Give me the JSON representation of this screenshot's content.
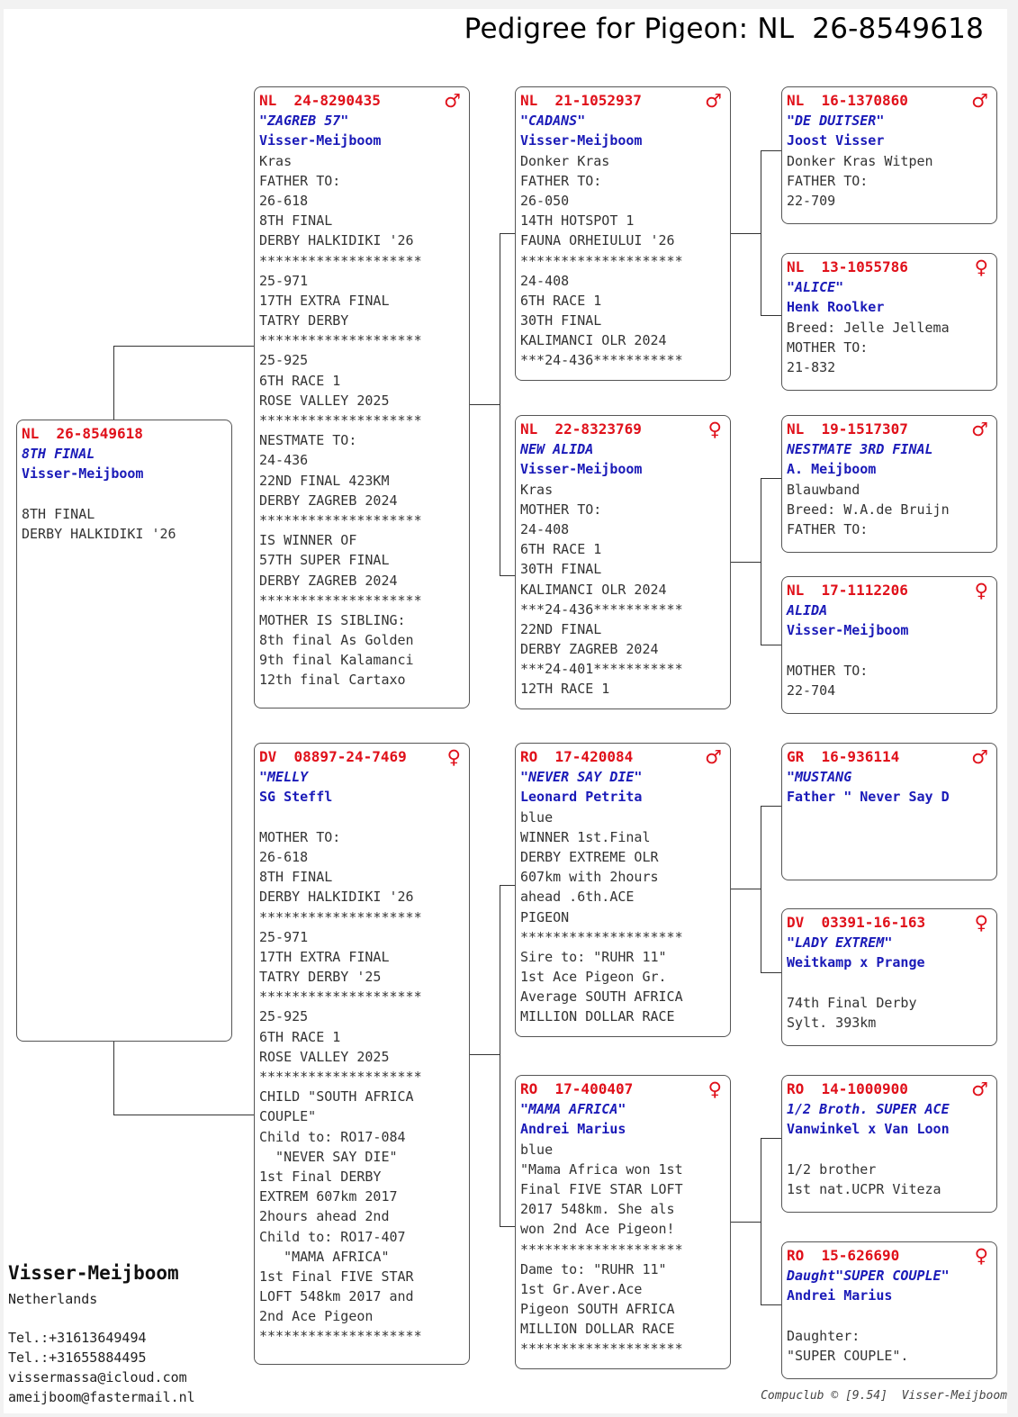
{
  "title": "Pedigree for Pigeon: NL  26-8549618",
  "boxes": {
    "subject": {
      "ring": "NL  26-8549618",
      "sex": "",
      "name": "8TH FINAL",
      "owner": "Visser-Meijboom",
      "lines": [
        "",
        "8TH FINAL",
        "DERBY HALKIDIKI '26"
      ]
    },
    "father": {
      "ring": "NL  24-8290435",
      "sex": "♂",
      "name": "\"ZAGREB 57\"",
      "owner": "Visser-Meijboom",
      "lines": [
        "Kras",
        "FATHER TO:",
        "26-618",
        "8TH FINAL",
        "DERBY HALKIDIKI '26",
        "********************",
        "25-971",
        "17TH EXTRA FINAL",
        "TATRY DERBY",
        "********************",
        "25-925",
        "6TH RACE 1",
        "ROSE VALLEY 2025",
        "********************",
        "NESTMATE TO:",
        "24-436",
        "22ND FINAL 423KM",
        "DERBY ZAGREB 2024",
        "********************",
        "IS WINNER OF",
        "57TH SUPER FINAL",
        "DERBY ZAGREB 2024",
        "********************",
        "MOTHER IS SIBLING:",
        "8th final As Golden",
        "9th final Kalamanci",
        "12th final Cartaxo"
      ]
    },
    "mother": {
      "ring": "DV  08897-24-7469",
      "sex": "♀",
      "name": "\"MELLY",
      "owner": "SG Steffl",
      "lines": [
        "",
        "MOTHER TO:",
        "26-618",
        "8TH FINAL",
        "DERBY HALKIDIKI '26",
        "********************",
        "25-971",
        "17TH EXTRA FINAL",
        "TATRY DERBY '25",
        "********************",
        "25-925",
        "6TH RACE 1",
        "ROSE VALLEY 2025",
        "********************",
        "CHILD \"SOUTH AFRICA",
        "COUPLE\"",
        "Child to: RO17-084",
        "  \"NEVER SAY DIE\"",
        "1st Final DERBY",
        "EXTREM 607km 2017",
        "2hours ahead 2nd",
        "Child to: RO17-407",
        "   \"MAMA AFRICA\"",
        "1st Final FIVE STAR",
        "LOFT 548km 2017 and",
        "2nd Ace Pigeon",
        "********************"
      ]
    },
    "ff": {
      "ring": "NL  21-1052937",
      "sex": "♂",
      "name": "\"CADANS\"",
      "owner": "Visser-Meijboom",
      "lines": [
        "Donker Kras",
        "FATHER TO:",
        "26-050",
        "14TH HOTSPOT 1",
        "FAUNA ORHEIULUI '26",
        "********************",
        "24-408",
        "6TH RACE 1",
        "30TH FINAL",
        "KALIMANCI OLR 2024",
        "***24-436***********"
      ]
    },
    "fm": {
      "ring": "NL  22-8323769",
      "sex": "♀",
      "name": "NEW ALIDA",
      "owner": "Visser-Meijboom",
      "lines": [
        "Kras",
        "MOTHER TO:",
        "24-408",
        "6TH RACE 1",
        "30TH FINAL",
        "KALIMANCI OLR 2024",
        "***24-436***********",
        "22ND FINAL",
        "DERBY ZAGREB 2024",
        "***24-401***********",
        "12TH RACE 1"
      ]
    },
    "mf": {
      "ring": "RO  17-420084",
      "sex": "♂",
      "name": "\"NEVER SAY DIE\"",
      "owner": "Leonard Petrita",
      "lines": [
        "blue",
        "WINNER 1st.Final",
        "DERBY EXTREME OLR",
        "607km with 2hours",
        "ahead .6th.ACE",
        "PIGEON",
        "********************",
        "Sire to: \"RUHR 11\"",
        "1st Ace Pigeon Gr.",
        "Average SOUTH AFRICA",
        "MILLION DOLLAR RACE"
      ]
    },
    "mm": {
      "ring": "RO  17-400407",
      "sex": "♀",
      "name": "\"MAMA AFRICA\"",
      "owner": "Andrei Marius",
      "lines": [
        "blue",
        "\"Mama Africa won 1st",
        "Final FIVE STAR LOFT",
        "2017 548km. She als",
        "won 2nd Ace Pigeon!",
        "********************",
        "Dame to: \"RUHR 11\"",
        "1st Gr.Aver.Ace",
        "Pigeon SOUTH AFRICA",
        "MILLION DOLLAR RACE",
        "********************"
      ]
    },
    "fff": {
      "ring": "NL  16-1370860",
      "sex": "♂",
      "name": "\"DE DUITSER\"",
      "owner": "Joost Visser",
      "lines": [
        "Donker Kras Witpen",
        "FATHER TO:",
        "22-709"
      ]
    },
    "ffm": {
      "ring": "NL  13-1055786",
      "sex": "♀",
      "name": "\"ALICE\"",
      "owner": "Henk Roolker",
      "lines": [
        "Breed: Jelle Jellema",
        "MOTHER TO:",
        "21-832"
      ]
    },
    "fmf": {
      "ring": "NL  19-1517307",
      "sex": "♂",
      "name": "NESTMATE 3RD FINAL",
      "owner": "A. Meijboom",
      "lines": [
        "Blauwband",
        "Breed: W.A.de Bruijn",
        "FATHER TO:"
      ]
    },
    "fmm": {
      "ring": "NL  17-1112206",
      "sex": "♀",
      "name": "ALIDA",
      "owner": "Visser-Meijboom",
      "lines": [
        "",
        "MOTHER TO:",
        "22-704"
      ]
    },
    "mff": {
      "ring": "GR  16-936114",
      "sex": "♂",
      "name": "\"MUSTANG",
      "owner": "Father \" Never Say D",
      "lines": []
    },
    "mfm": {
      "ring": "DV  03391-16-163",
      "sex": "♀",
      "name": "\"LADY EXTREM\"",
      "owner": "Weitkamp x Prange",
      "lines": [
        "",
        "74th Final Derby",
        "Sylt. 393km"
      ]
    },
    "mmf": {
      "ring": "RO  14-1000900",
      "sex": "♂",
      "name": "1/2 Broth. SUPER ACE",
      "owner": "Vanwinkel x Van Loon",
      "lines": [
        "",
        "1/2 brother",
        "1st nat.UCPR Viteza"
      ]
    },
    "mmm": {
      "ring": "RO  15-626690",
      "sex": "♀",
      "name": "Daught\"SUPER COUPLE\"",
      "owner": "Andrei Marius",
      "lines": [
        "",
        "Daughter:",
        "\"SUPER COUPLE\"."
      ]
    }
  },
  "breeder": {
    "name": "Visser-Meijboom",
    "country": "Netherlands",
    "tel1": "Tel.:+31613649494",
    "tel2": "Tel.:+31655884495",
    "email1": "vissermassa@icloud.com",
    "email2": "ameijboom@fastermail.nl"
  },
  "credit": "Compuclub © [9.54]  Visser-Meijboom"
}
